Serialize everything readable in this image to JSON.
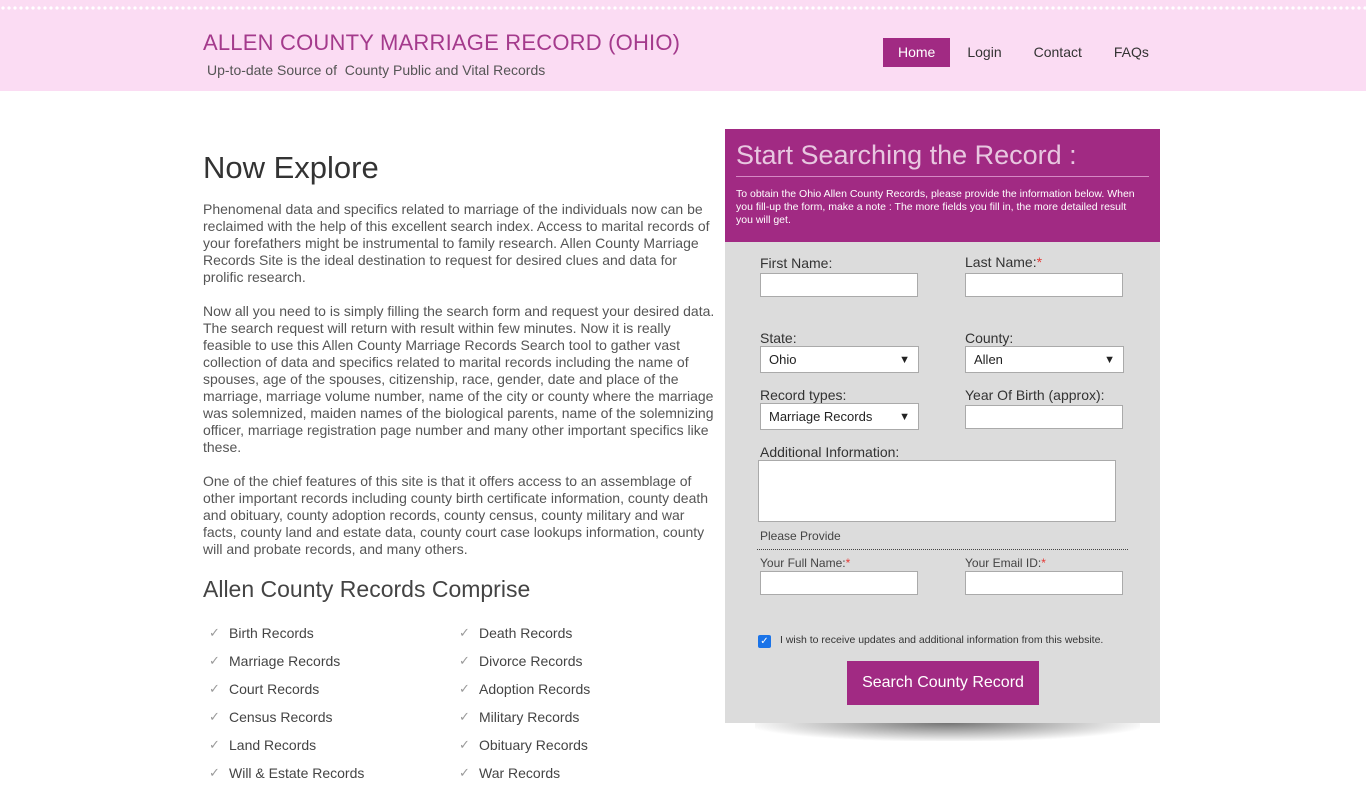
{
  "header": {
    "title": "ALLEN COUNTY MARRIAGE RECORD (OHIO)",
    "subtitle": "Up-to-date Source of  County Public and Vital Records",
    "nav": [
      "Home",
      "Login",
      "Contact",
      "FAQs"
    ],
    "active_nav": "Home"
  },
  "main": {
    "heading": "Now Explore",
    "paragraphs": [
      "Phenomenal data and specifics related to marriage of the individuals now can be reclaimed with the help of this excellent search index. Access to marital records of your forefathers might be instrumental to family research. Allen County Marriage Records Site is the ideal destination to request for desired clues and data for prolific research.",
      "Now all you need to is simply filling the search form and request your desired data. The search request will return with result within few minutes. Now it is really feasible to use this Allen County Marriage Records Search tool to gather vast collection of data and specifics related to marital records including the name of spouses, age of the spouses, citizenship, race, gender, date and place of the marriage, marriage volume number, name of the city or county where the marriage was solemnized, maiden names of the biological parents, name of the solemnizing officer, marriage registration page number and many other important specifics like these.",
      "One of the chief features of this site is that it offers access to an assemblage of other important records including county birth certificate information, county death and obituary, county adoption records, county census, county military and war facts, county land and estate data, county court case lookups information, county will and probate records, and many others."
    ],
    "comprise_heading": "Allen County Records Comprise",
    "records_left": [
      "Birth Records",
      "Marriage Records",
      "Court Records",
      "Census Records",
      "Land Records",
      "Will & Estate Records"
    ],
    "records_right": [
      "Death Records",
      "Divorce Records",
      "Adoption Records",
      "Military Records",
      "Obituary Records",
      "War Records"
    ]
  },
  "form": {
    "title": "Start Searching the Record :",
    "intro": "To obtain the Ohio Allen County Records, please provide the information below. When you fill-up the form, make a note : The more fields you fill in, the more detailed result you will get.",
    "first_name_label": "First Name:",
    "last_name_label": "Last Name:",
    "required_mark": "*",
    "state_label": "State:",
    "state_value": "Ohio",
    "county_label": "County:",
    "county_value": "Allen",
    "record_types_label": "Record types:",
    "record_types_value": "Marriage Records",
    "yob_label": "Year Of Birth (approx):",
    "additional_label": "Additional Information:",
    "please_provide": "Please Provide",
    "full_name_label": "Your Full Name:",
    "email_label": "Your Email ID:",
    "checkbox_label": "I wish to receive updates and additional information from this website.",
    "checkbox_checked": true,
    "submit_label": "Search County Record"
  },
  "icons": {
    "check": "checkmark-icon",
    "chevron": "chevron-down-icon"
  },
  "colors": {
    "accent": "#a12a83",
    "header_bg": "#fbdcf3",
    "panel_bg": "#dcdcdc"
  }
}
